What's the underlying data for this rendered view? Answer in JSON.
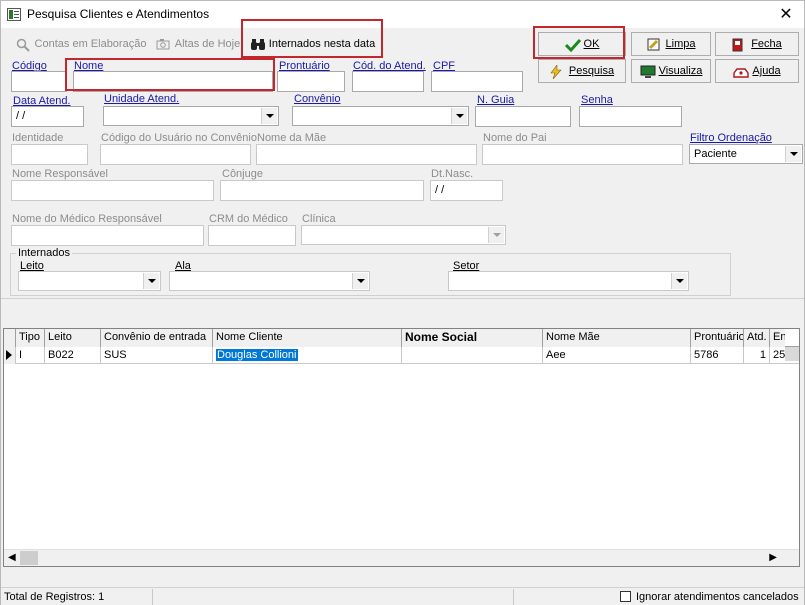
{
  "window": {
    "title": "Pesquisa Clientes e Atendimentos"
  },
  "toolbar": {
    "contas_label": "Contas em Elaboração",
    "altas_label": "Altas de Hoje",
    "internados_label": "Internados nesta data",
    "ok_label": "OK",
    "limpa_label": "Limpa",
    "fecha_label": "Fecha",
    "pesquisa_label": "Pesquisa",
    "visualiza_label": "Visualiza",
    "ajuda_label": "Ajuda"
  },
  "form": {
    "codigo": {
      "label": "Código",
      "value": ""
    },
    "nome": {
      "label": "Nome",
      "value": ""
    },
    "prontuario": {
      "label": "Prontuário",
      "value": ""
    },
    "cod_atend": {
      "label": "Cód. do Atend.",
      "value": ""
    },
    "cpf": {
      "label": "CPF",
      "value": ""
    },
    "data_atend": {
      "label": "Data Atend.",
      "value": " / /"
    },
    "unidade_atend": {
      "label": "Unidade Atend.",
      "value": ""
    },
    "convenio": {
      "label": "Convênio",
      "value": ""
    },
    "n_guia": {
      "label": "N. Guia",
      "value": ""
    },
    "senha": {
      "label": "Senha",
      "value": ""
    },
    "identidade": {
      "label": "Identidade"
    },
    "cod_usuario_convenio": {
      "label": "Código do Usuário no Convênio"
    },
    "nome_mae": {
      "label": "Nome da Mãe"
    },
    "nome_pai": {
      "label": "Nome do Pai"
    },
    "filtro_ordenacao": {
      "label": "Filtro Ordenação",
      "value": "Paciente"
    },
    "nome_responsavel": {
      "label": "Nome Responsável"
    },
    "conjuge": {
      "label": "Cônjuge"
    },
    "dt_nasc": {
      "label": "Dt.Nasc.",
      "value": " / /"
    },
    "nome_medico": {
      "label": "Nome do Médico Responsável"
    },
    "crm_medico": {
      "label": "CRM do Médico"
    },
    "clinica": {
      "label": "Clínica"
    }
  },
  "internados": {
    "group_label": "Internados",
    "leito_label": "Leito",
    "ala_label": "Ala",
    "setor_label": "Setor"
  },
  "grid": {
    "columns": [
      "Tipo",
      "Leito",
      "Convênio de entrada",
      "Nome Cliente",
      "Nome Social",
      "Nome Mãe",
      "Prontuário",
      "Atd.",
      "En"
    ],
    "rows": [
      [
        "I",
        "B022",
        "SUS",
        "Douglas Collioni",
        "",
        "Aee",
        "5786",
        "1",
        "25"
      ]
    ]
  },
  "status": {
    "total_registros": "Total de Registros: 1",
    "ignorar_label": "Ignorar atendimentos cancelados"
  },
  "icons": {
    "ok": "checkmark-icon",
    "limpa": "clear-icon",
    "fecha": "exit-icon",
    "pesquisa": "lightning-icon",
    "visualiza": "monitor-icon",
    "ajuda": "help-icon",
    "internados": "binoculars-icon"
  },
  "colors": {
    "highlight_box": "#c0282d",
    "label_blue": "#1a1aa6",
    "selection": "#0078d7"
  }
}
